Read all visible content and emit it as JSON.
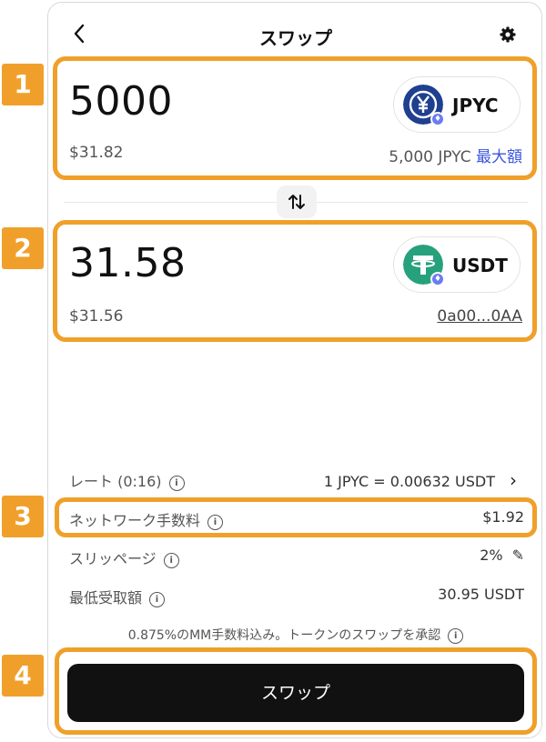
{
  "header": {
    "title": "スワップ",
    "back_glyph": "‹"
  },
  "sell": {
    "amount": "5000",
    "usd": "$31.82",
    "token": "JPYC",
    "balance": "5,000 JPYC",
    "max_label": "最大額",
    "icon": "yen-coin-icon"
  },
  "buy": {
    "amount": "31.58",
    "usd": "$31.56",
    "token": "USDT",
    "address": "0a00...0AA",
    "icon": "tether-icon"
  },
  "details": {
    "rate_label": "レート (0:16)",
    "rate_value": "1 JPYC = 0.00632 USDT",
    "fee_label": "ネットワーク手数料",
    "fee_value": "$1.92",
    "slippage_label": "スリッページ",
    "slippage_value": "2%",
    "min_label": "最低受取額",
    "min_value": "30.95 USDT"
  },
  "note": "0.875%のMM手数料込み。トークンのスワップを承認",
  "swap_button_label": "スワップ",
  "badges": [
    "1",
    "2",
    "3",
    "4"
  ],
  "colors": {
    "highlight": "#f0a02a",
    "link": "#3b56e0",
    "jpyc": "#1f3f8f",
    "usdt": "#26a17b",
    "button": "#111111"
  }
}
